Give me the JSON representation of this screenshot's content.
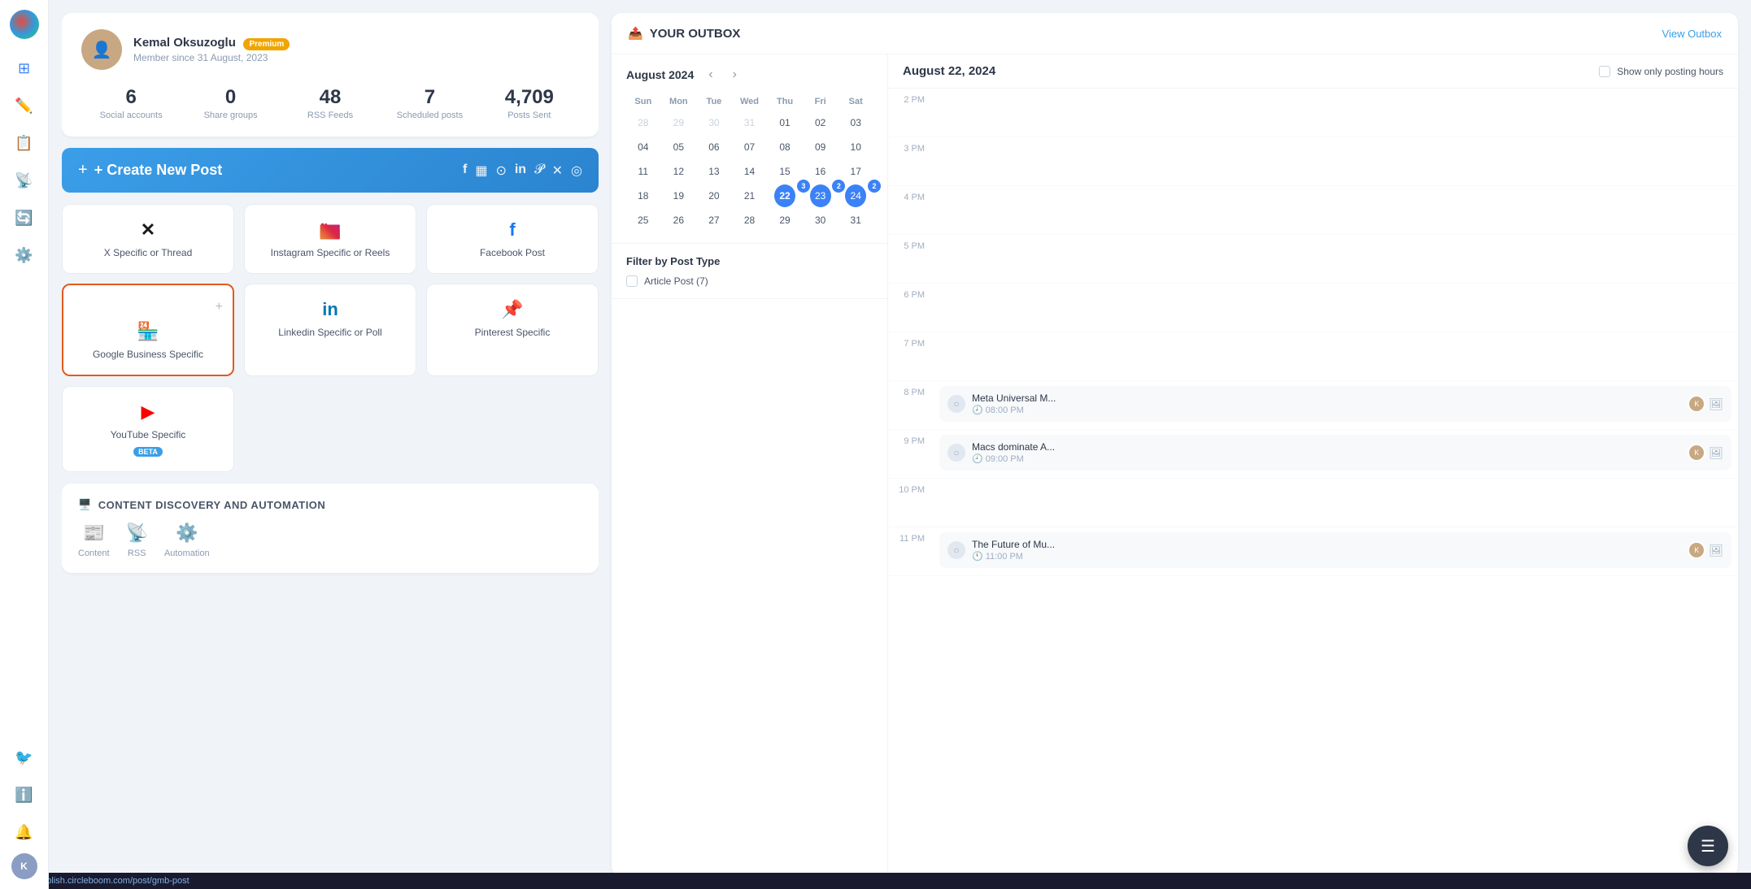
{
  "sidebar": {
    "logo_label": "Circleboom",
    "items": [
      {
        "icon": "⊞",
        "label": "dashboard",
        "active": false
      },
      {
        "icon": "✏️",
        "label": "compose",
        "active": false
      },
      {
        "icon": "📋",
        "label": "queue",
        "active": false
      },
      {
        "icon": "📡",
        "label": "rss",
        "active": false
      },
      {
        "icon": "🔄",
        "label": "recycle",
        "active": false
      },
      {
        "icon": "⚙️",
        "label": "settings",
        "active": false
      }
    ],
    "bottom_items": [
      {
        "icon": "🐦",
        "label": "twitter",
        "active": false
      },
      {
        "icon": "ℹ️",
        "label": "info",
        "active": false
      },
      {
        "icon": "🔔",
        "label": "notifications",
        "active": false
      }
    ]
  },
  "profile": {
    "name": "Kemal Oksuzoglu",
    "badge": "Premium",
    "since": "Member since 31 August, 2023"
  },
  "stats": [
    {
      "value": "6",
      "label": "Social accounts"
    },
    {
      "value": "0",
      "label": "Share groups"
    },
    {
      "value": "48",
      "label": "RSS Feeds"
    },
    {
      "value": "7",
      "label": "Scheduled posts"
    },
    {
      "value": "4,709",
      "label": "Posts Sent"
    }
  ],
  "create_post": {
    "label": "+ Create New Post",
    "icons": [
      "f",
      "▦",
      "⊙",
      "in",
      "𝓟",
      "✕",
      "◎"
    ]
  },
  "post_types": [
    {
      "icon": "✕",
      "label": "X Specific or Thread",
      "selected": false,
      "platform": "x"
    },
    {
      "icon": "📷",
      "label": "Instagram Specific or Reels",
      "selected": false,
      "platform": "instagram"
    },
    {
      "icon": "f",
      "label": "Facebook Post",
      "selected": false,
      "platform": "facebook"
    },
    {
      "icon": "🏪",
      "label": "Google Business Specific",
      "selected": true,
      "platform": "google"
    },
    {
      "icon": "in",
      "label": "Linkedin Specific or Poll",
      "selected": false,
      "platform": "linkedin"
    },
    {
      "icon": "📌",
      "label": "Pinterest Specific",
      "selected": false,
      "platform": "pinterest"
    },
    {
      "icon": "▶",
      "label": "YouTube Specific",
      "selected": false,
      "platform": "youtube",
      "beta": true
    }
  ],
  "discovery": {
    "title": "CONTENT DISCOVERY AND AUTOMATION",
    "items": [
      {
        "icon": "📰",
        "label": "Content"
      },
      {
        "icon": "📡",
        "label": "RSS"
      },
      {
        "icon": "⚙️",
        "label": "Automation"
      }
    ]
  },
  "outbox": {
    "title": "YOUR OUTBOX",
    "view_link": "View Outbox",
    "calendar": {
      "month": "August 2024",
      "days_header": [
        "Sun",
        "Mon",
        "Tue",
        "Wed",
        "Thu",
        "Fri",
        "Sat"
      ],
      "weeks": [
        [
          {
            "day": "28",
            "other": true
          },
          {
            "day": "29",
            "other": true
          },
          {
            "day": "30",
            "other": true
          },
          {
            "day": "31",
            "other": true
          },
          {
            "day": "01"
          },
          {
            "day": "02"
          },
          {
            "day": "03"
          }
        ],
        [
          {
            "day": "04"
          },
          {
            "day": "05"
          },
          {
            "day": "06"
          },
          {
            "day": "07"
          },
          {
            "day": "08"
          },
          {
            "day": "09"
          },
          {
            "day": "10"
          }
        ],
        [
          {
            "day": "11"
          },
          {
            "day": "12"
          },
          {
            "day": "13"
          },
          {
            "day": "14"
          },
          {
            "day": "15"
          },
          {
            "day": "16"
          },
          {
            "day": "17"
          }
        ],
        [
          {
            "day": "18"
          },
          {
            "day": "19"
          },
          {
            "day": "20"
          },
          {
            "day": "21"
          },
          {
            "day": "22",
            "today": true,
            "badge": "3"
          },
          {
            "day": "23",
            "badge": "2"
          },
          {
            "day": "24",
            "badge": "2"
          }
        ],
        [
          {
            "day": "25"
          },
          {
            "day": "26"
          },
          {
            "day": "27"
          },
          {
            "day": "28"
          },
          {
            "day": "29"
          },
          {
            "day": "30"
          },
          {
            "day": "31"
          }
        ]
      ]
    },
    "filter": {
      "title": "Filter by Post Type",
      "items": [
        {
          "label": "Article Post (7)",
          "checked": false
        }
      ]
    },
    "schedule": {
      "date": "August 22, 2024",
      "show_posting_hours_label": "Show only posting hours",
      "timeline": [
        {
          "time": "2 PM",
          "posts": []
        },
        {
          "time": "3 PM",
          "posts": []
        },
        {
          "time": "4 PM",
          "posts": []
        },
        {
          "time": "5 PM",
          "posts": []
        },
        {
          "time": "6 PM",
          "posts": []
        },
        {
          "time": "7 PM",
          "posts": []
        },
        {
          "time": "8 PM",
          "posts": [
            {
              "title": "Meta Universal M...",
              "time": "08:00 PM",
              "avatar": "K",
              "has_image": true
            }
          ]
        },
        {
          "time": "9 PM",
          "posts": [
            {
              "title": "Macs dominate A...",
              "time": "09:00 PM",
              "avatar": "K",
              "has_image": true
            }
          ]
        },
        {
          "time": "10 PM",
          "posts": []
        },
        {
          "time": "11 PM",
          "posts": [
            {
              "title": "The Future of Mu...",
              "time": "11:00 PM",
              "avatar": "K",
              "has_image": true
            }
          ]
        }
      ]
    }
  },
  "fab_label": "☰",
  "status_bar_url": "https://publish.circleboom.com/post/gmb-post"
}
